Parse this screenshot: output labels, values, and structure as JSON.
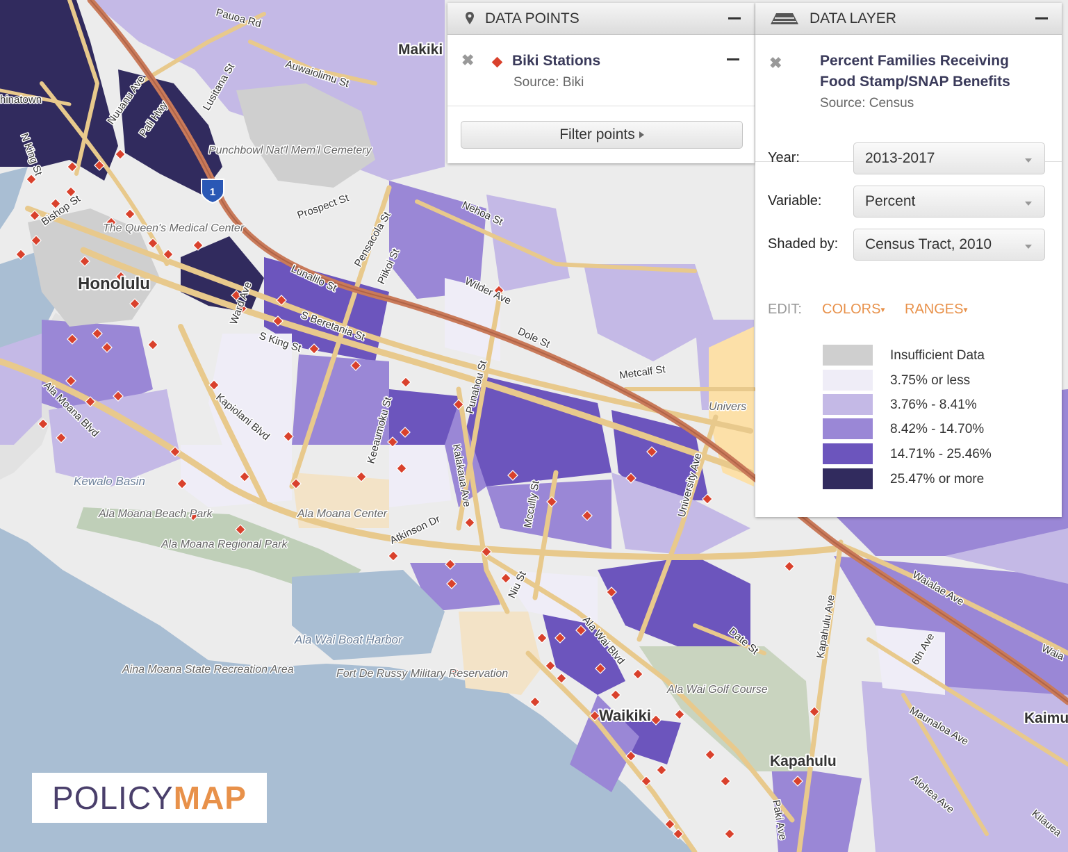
{
  "map": {
    "place_labels": [
      {
        "text": "Honolulu"
      },
      {
        "text": "Waikiki"
      },
      {
        "text": "Kapahulu"
      },
      {
        "text": "Kaimu"
      },
      {
        "text": "Makiki"
      },
      {
        "text": "hinatown"
      }
    ],
    "street_labels": [
      "Pauoa Rd",
      "Auwaiolimu St",
      "Nuuanu Ave",
      "Pali Hwy",
      "Lusitana St",
      "Prospect St",
      "Pensacola St",
      "Piikoi St",
      "Nehoa St",
      "Wilder Ave",
      "Lunalilo St",
      "S Beretania St",
      "S King St",
      "Ward Ave",
      "Kapiolani Blvd",
      "Ala Moana Blvd",
      "Dole St",
      "Metcalf St",
      "Punahou St",
      "Kalakaua Ave",
      "Keeaumoku St",
      "Mccully St",
      "Atkinson Dr",
      "Niu St",
      "Ala Wai Blvd",
      "Date St",
      "Kapahulu Ave",
      "Waialae Ave",
      "6th Ave",
      "Maunaloa Ave",
      "Alohea Ave",
      "Paki Ave",
      "University Ave",
      "Bishop St",
      "N King St",
      "Kilauea",
      "Waia"
    ],
    "park_labels": [
      "Punchbowl Nat'l Mem'l Cemetery",
      "The Queen's Medical Center",
      "Kewalo Basin",
      "Ala Moana Beach Park",
      "Ala Moana Regional Park",
      "Ala Moana Center",
      "Ala Wai Boat Harbor",
      "Aina Moana State Recreation Area",
      "Fort De Russy Military Reservation",
      "Ala Wai Golf Course",
      "Univers"
    ],
    "highway_shield": "1",
    "colors": {
      "water": "#a9bed3",
      "land": "#ececec",
      "road": "#e8c98c",
      "freeway": "#c97a5a",
      "park": "#bfcfb8",
      "sand": "#f3e3c7",
      "marker": "#d9412c"
    }
  },
  "data_points_panel": {
    "title": "DATA POINTS",
    "layer_name": "Biki Stations",
    "source_label": "Source:",
    "source_value": "Biki",
    "filter_button": "Filter points"
  },
  "data_layer_panel": {
    "title": "DATA LAYER",
    "layer_name_line1": "Percent Families Receiving",
    "layer_name_line2": "Food Stamp/SNAP Benefits",
    "source_label": "Source:",
    "source_value": "Census",
    "year_label": "Year:",
    "year_value": "2013-2017",
    "variable_label": "Variable:",
    "variable_value": "Percent",
    "shaded_label": "Shaded by:",
    "shaded_value": "Census Tract, 2010",
    "edit_label": "EDIT:",
    "colors_link": "COLORS",
    "ranges_link": "RANGES",
    "legend": [
      {
        "label": "Insufficient Data",
        "color": "#cfcfcf"
      },
      {
        "label": "3.75% or less",
        "color": "#efedf7"
      },
      {
        "label": "3.76% - 8.41%",
        "color": "#c4b9e6"
      },
      {
        "label": "8.42% - 14.70%",
        "color": "#9a87d6"
      },
      {
        "label": "14.71% - 25.46%",
        "color": "#6c55bd"
      },
      {
        "label": "25.47% or more",
        "color": "#312b5e"
      }
    ]
  },
  "logo": {
    "part1": "POLICY",
    "part2": "MAP"
  }
}
